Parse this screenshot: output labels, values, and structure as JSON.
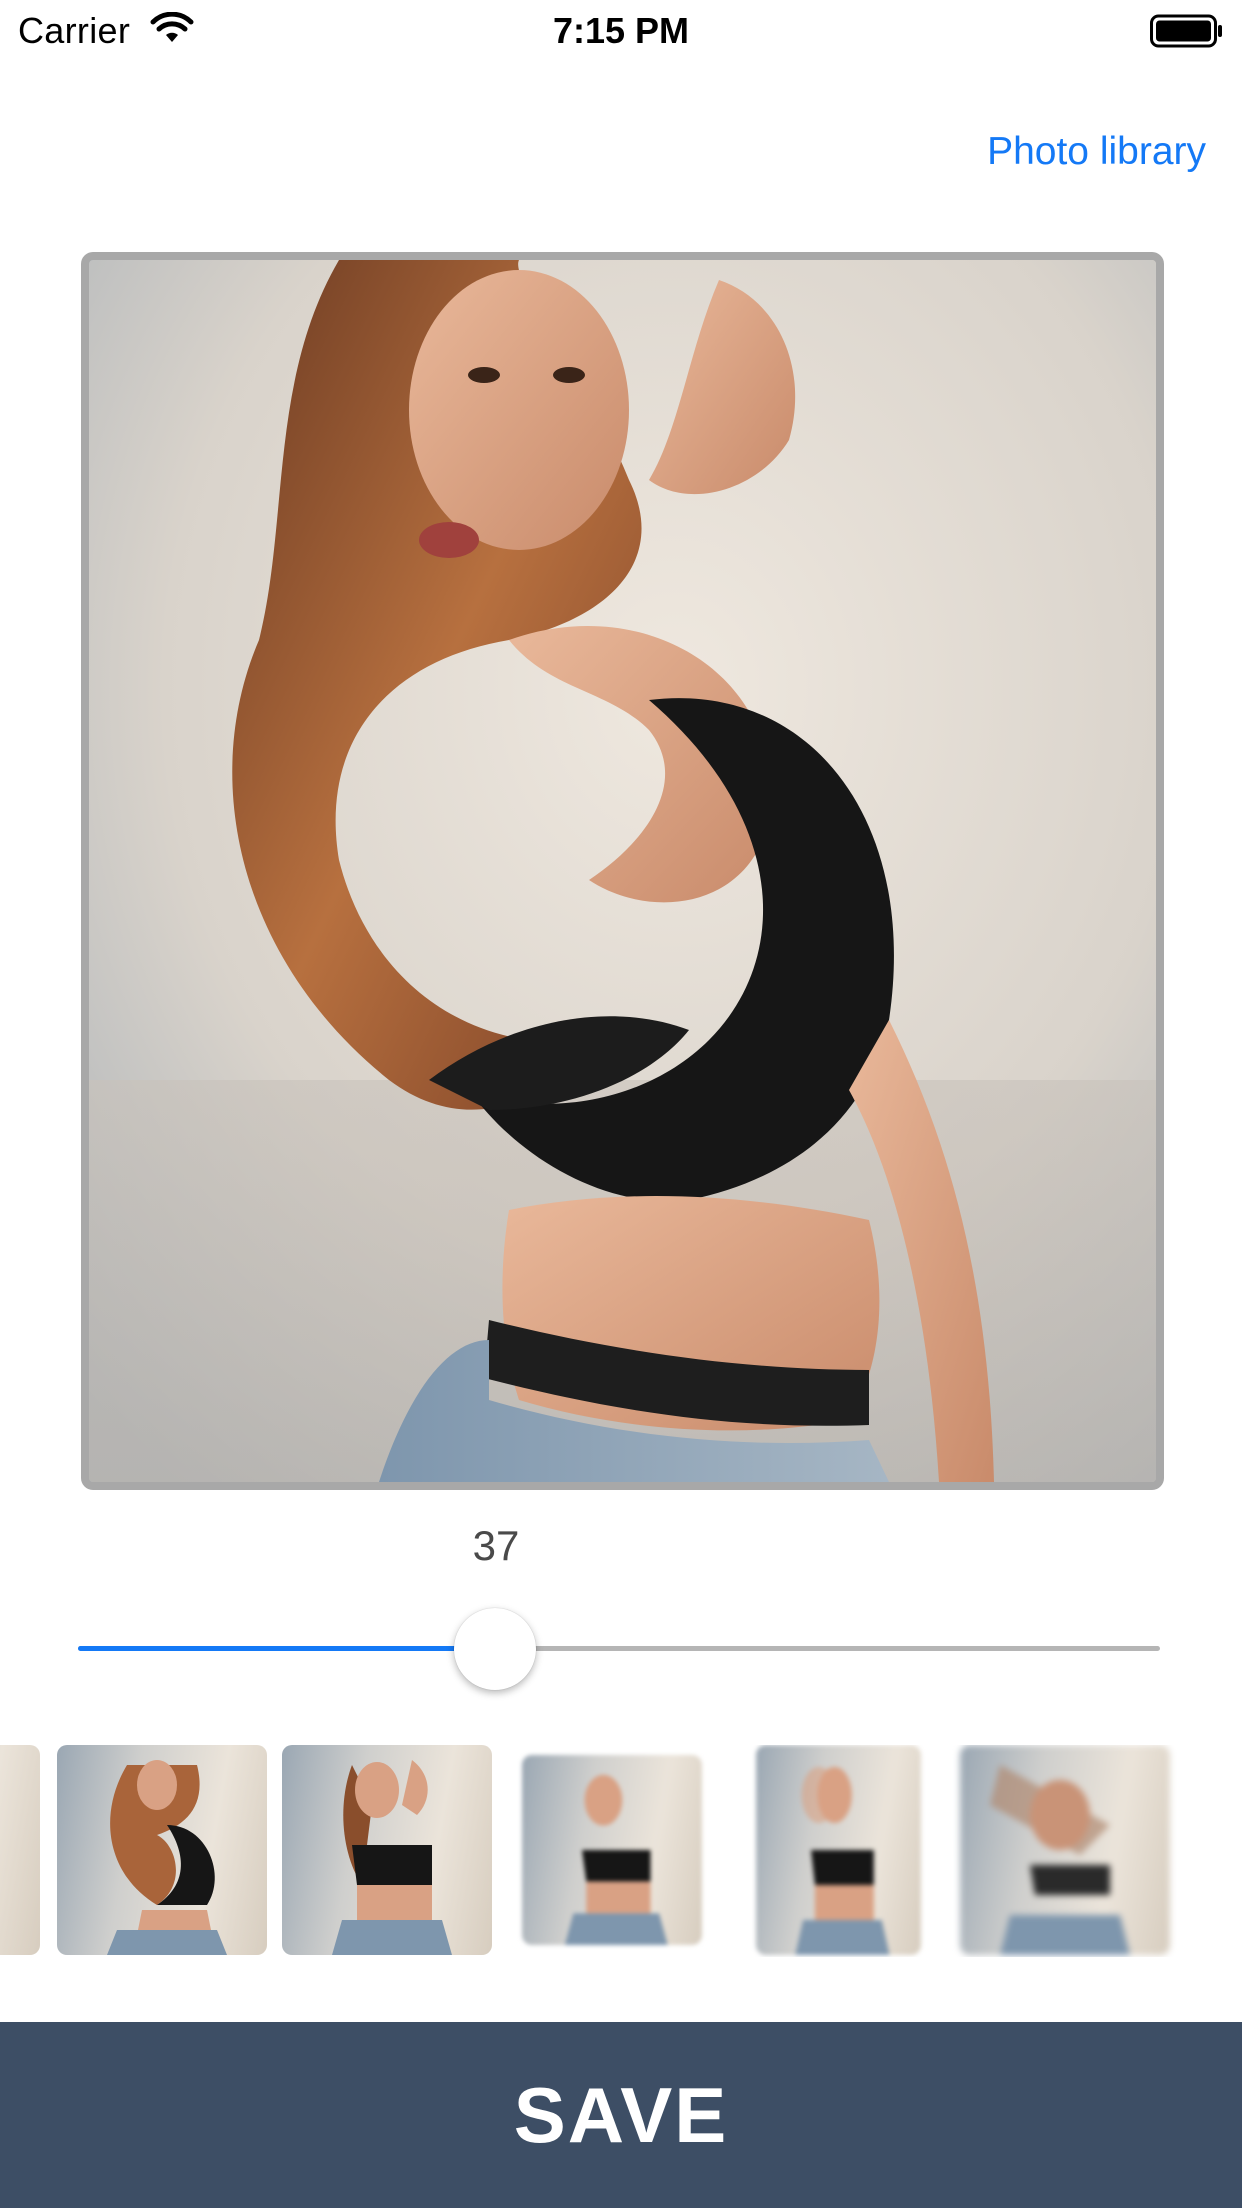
{
  "status_bar": {
    "carrier": "Carrier",
    "time": "7:15 PM",
    "wifi_icon": "wifi-icon",
    "battery_icon": "battery-icon"
  },
  "nav": {
    "photo_library_label": "Photo library"
  },
  "preview": {
    "image_icon": "edited-photo-swirl",
    "frame_color": "#a8a8a8"
  },
  "effect": {
    "value": "37",
    "slider_fraction": 0.385
  },
  "thumbnails": [
    {
      "effect": "swirl-partial"
    },
    {
      "effect": "swirl"
    },
    {
      "effect": "original"
    },
    {
      "effect": "blur"
    },
    {
      "effect": "motion-blur"
    },
    {
      "effect": "zoom-blur"
    }
  ],
  "save": {
    "label": "SAVE",
    "bar_color": "#3d4e65"
  },
  "colors": {
    "accent": "#1479f6",
    "track": "#b5b5b5"
  }
}
